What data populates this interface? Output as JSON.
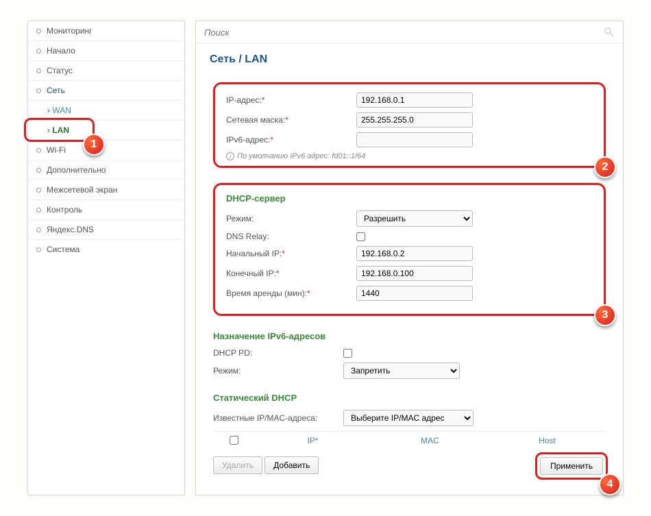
{
  "sidebar": {
    "items": [
      {
        "label": "Мониторинг",
        "cls": "level1"
      },
      {
        "label": "Начало",
        "cls": "level1"
      },
      {
        "label": "Статус",
        "cls": "level1"
      },
      {
        "label": "Сеть",
        "cls": "level1 top-active"
      },
      {
        "label": "WAN",
        "cls": "level2"
      },
      {
        "label": "LAN",
        "cls": "level2 active"
      },
      {
        "label": "Wi-Fi",
        "cls": "level1"
      },
      {
        "label": "Дополнительно",
        "cls": "level1"
      },
      {
        "label": "Межсетевой экран",
        "cls": "level1"
      },
      {
        "label": "Контроль",
        "cls": "level1"
      },
      {
        "label": "Яндекс.DNS",
        "cls": "level1"
      },
      {
        "label": "Система",
        "cls": "level1"
      }
    ]
  },
  "search": {
    "placeholder": "Поиск"
  },
  "breadcrumb": "Сеть /  LAN",
  "box1": {
    "ip_label": "IP-адрес:",
    "ip_value": "192.168.0.1",
    "mask_label": "Сетевая маска:",
    "mask_value": "255.255.255.0",
    "ipv6_label": "IPv6-адрес:",
    "ipv6_value": "",
    "hint": "По умолчанию IPv6 адрес: fd01::1/64"
  },
  "box2": {
    "title": "DHCP-сервер",
    "mode_label": "Режим:",
    "mode_value": "Разрешить",
    "dns_label": "DNS Relay:",
    "start_label": "Начальный IP:",
    "start_value": "192.168.0.2",
    "end_label": "Конечный IP:",
    "end_value": "192.168.0.100",
    "lease_label": "Время аренды (мин):",
    "lease_value": "1440"
  },
  "ipv6": {
    "title": "Назначение IPv6-адресов",
    "pd_label": "DHCP PD:",
    "mode_label": "Режим:",
    "mode_value": "Запретить"
  },
  "static": {
    "title": "Статический DHCP",
    "known_label": "Известные IP/MAC-адреса:",
    "select_value": "Выберите IP/MAC адрес",
    "col_ip": "IP*",
    "col_mac": "MAC",
    "col_host": "Host",
    "delete_btn": "Удалить",
    "add_btn": "Добавить"
  },
  "apply_btn": "Применить",
  "markers": {
    "m1": "1",
    "m2": "2",
    "m3": "3",
    "m4": "4"
  }
}
